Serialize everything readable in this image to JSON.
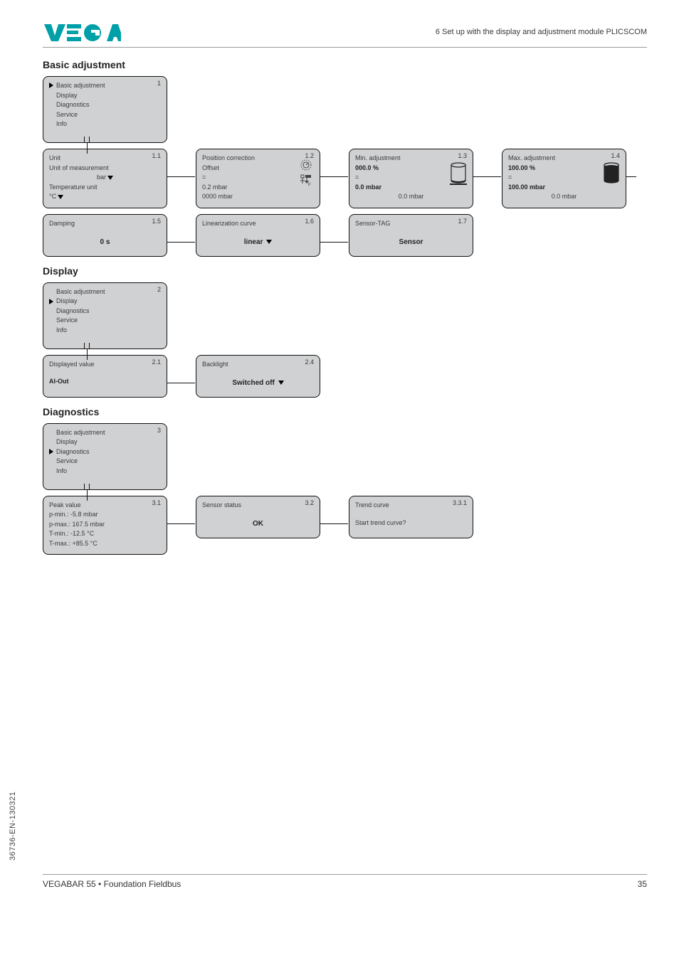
{
  "header": {
    "logo_text": "VEGA",
    "right": "6 Set up with the display and adjustment module PLICSCOM"
  },
  "sections": {
    "basic": "Basic adjustment",
    "display": "Display",
    "diagnostics": "Diagnostics"
  },
  "menu1": {
    "num": "1",
    "items": [
      "Basic adjustment",
      "Display",
      "Diagnostics",
      "Service",
      "Info"
    ],
    "selected": 0
  },
  "box11": {
    "num": "1.1",
    "title": "Unit",
    "l2": "Unit of measurement",
    "l3": "bar",
    "l4": "Temperature unit",
    "l5": "°C"
  },
  "box12": {
    "num": "1.2",
    "title": "Position correction",
    "l2": "Offset",
    "l3": "=",
    "l4": "0.2 mbar",
    "l5": "0000 mbar"
  },
  "box13": {
    "num": "1.3",
    "title": "Min. adjustment",
    "l2": "000.0 %",
    "l3": "=",
    "l4": "0.0 mbar",
    "l5": "0.0 mbar"
  },
  "box14": {
    "num": "1.4",
    "title": "Max. adjustment",
    "l2": "100.00 %",
    "l3": "=",
    "l4": "100.00 mbar",
    "l5": "0.0 mbar"
  },
  "box15": {
    "num": "1.5",
    "title": "Damping",
    "val": "0 s"
  },
  "box16": {
    "num": "1.6",
    "title": "Linearization curve",
    "val": "linear"
  },
  "box17": {
    "num": "1.7",
    "title": "Sensor-TAG",
    "val": "Sensor"
  },
  "menu2": {
    "num": "2",
    "items": [
      "Basic adjustment",
      "Display",
      "Diagnostics",
      "Service",
      "Info"
    ],
    "selected": 1
  },
  "box21": {
    "num": "2.1",
    "title": "Displayed value",
    "val": "AI-Out"
  },
  "box24": {
    "num": "2.4",
    "title": "Backlight",
    "val": "Switched off"
  },
  "menu3": {
    "num": "3",
    "items": [
      "Basic adjustment",
      "Display",
      "Diagnostics",
      "Service",
      "Info"
    ],
    "selected": 2
  },
  "box31": {
    "num": "3.1",
    "title": "Peak value",
    "l2": "p-min.: -5.8 mbar",
    "l3": "p-max.: 167.5 mbar",
    "l4": "T-min.: -12.5 °C",
    "l5": "T-max.: +85.5 °C"
  },
  "box32": {
    "num": "3.2",
    "title": "Sensor status",
    "val": "OK"
  },
  "box331": {
    "num": "3.3.1",
    "title": "Trend curve",
    "val": "Start trend curve?"
  },
  "footer": {
    "left": "VEGABAR 55 • Foundation Fieldbus",
    "right": "35"
  },
  "side": "36736-EN-130321"
}
